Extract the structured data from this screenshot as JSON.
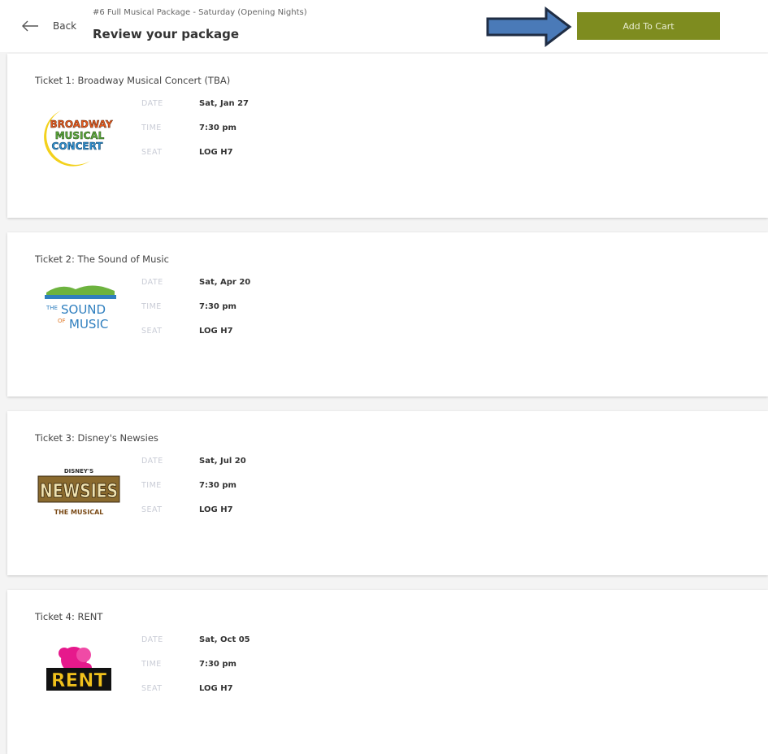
{
  "header": {
    "back_label": "Back",
    "package_name": "#6 Full Musical Package - Saturday (Opening Nights)",
    "page_title": "Review your package",
    "add_to_cart_label": "Add To Cart"
  },
  "labels": {
    "date": "DATE",
    "time": "TIME",
    "seat": "SEAT"
  },
  "tickets": [
    {
      "title": "Ticket 1: Broadway Musical Concert (TBA)",
      "date": "Sat, Jan 27",
      "time": "7:30 pm",
      "seat": "LOG H7",
      "logo": {
        "line1": "BROADWAY",
        "line2": "MUSICAL",
        "line3": "CONCERT"
      }
    },
    {
      "title": "Ticket 2: The Sound of Music",
      "date": "Sat, Apr 20",
      "time": "7:30 pm",
      "seat": "LOG H7",
      "logo": {
        "line1": "THE",
        "line2": "SOUND",
        "line3": "OF",
        "line4": "MUSIC"
      }
    },
    {
      "title": "Ticket 3: Disney's Newsies",
      "date": "Sat, Jul 20",
      "time": "7:30 pm",
      "seat": "LOG H7",
      "logo": {
        "line1": "DISNEY'S",
        "line2": "NEWSIES",
        "line3": "THE MUSICAL"
      }
    },
    {
      "title": "Ticket 4: RENT",
      "date": "Sat, Oct 05",
      "time": "7:30 pm",
      "seat": "LOG H7",
      "logo": {
        "line1": "RENT"
      }
    }
  ],
  "colors": {
    "button": "#7e8c1f",
    "arrow_fill": "#4a7ab8",
    "arrow_outline": "#1f2d44"
  }
}
